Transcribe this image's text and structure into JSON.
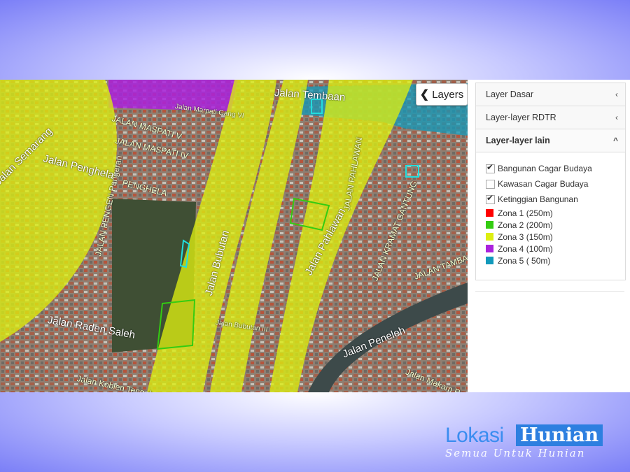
{
  "map": {
    "layers_button": "Layers",
    "street_labels": [
      {
        "text": "Jalan Tembaan"
      },
      {
        "text": "JALAN MASPATI V"
      },
      {
        "text": "Jalan Marpati Gang VI"
      },
      {
        "text": "JALAN MASPATI IV"
      },
      {
        "text": "Jalan Penghela"
      },
      {
        "text": "PENGHELA"
      },
      {
        "text": "Jalan Bubutan"
      },
      {
        "text": "Jalan Pahlawan"
      },
      {
        "text": "JALAN PAHLAWAN"
      },
      {
        "text": "JALAN KRAMAT GANTUNG"
      },
      {
        "text": "Jalan Raden Saleh"
      },
      {
        "text": "Jalan Peneleh"
      },
      {
        "text": "JALAN PENGEN Pangeran"
      },
      {
        "text": "Jalan Koblen Tengah"
      },
      {
        "text": "Jalan Makam Peneleh"
      },
      {
        "text": "JALAN TAMBA"
      },
      {
        "text": "Jalan Semarang"
      },
      {
        "text": "Jalan Bubutan III"
      }
    ]
  },
  "panel": {
    "sections": [
      {
        "label": "Layer Dasar",
        "arrow": "‹"
      },
      {
        "label": "Layer-layer RDTR",
        "arrow": "‹"
      },
      {
        "label": "Layer-layer lain",
        "arrow": "^"
      }
    ],
    "checks": [
      {
        "label": "Bangunan Cagar Budaya",
        "checked": true
      },
      {
        "label": "Kawasan Cagar Budaya",
        "checked": false
      },
      {
        "label": "Ketinggian Bangunan",
        "checked": true
      }
    ],
    "zones": [
      {
        "label": "Zona 1 (250m)",
        "color": "#ff0000"
      },
      {
        "label": "Zona 2 (200m)",
        "color": "#33cc11"
      },
      {
        "label": "Zona 3 (150m)",
        "color": "#ddee11"
      },
      {
        "label": "Zona 4 (100m)",
        "color": "#aa22dd"
      },
      {
        "label": "Zona 5 ( 50m)",
        "color": "#1199bb"
      }
    ]
  },
  "brand": {
    "part1": "Lokasi",
    "part2": "Hunian",
    "tagline": "Semua Untuk Hunian"
  }
}
